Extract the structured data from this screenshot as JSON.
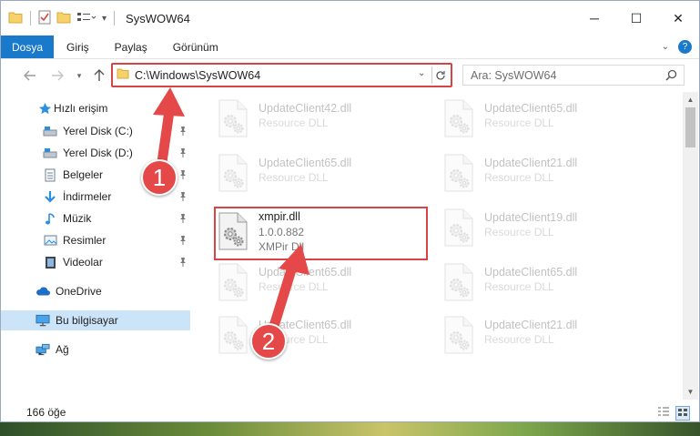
{
  "window": {
    "title": "SysWOW64",
    "controls": {
      "minimize": "─",
      "maximize": "☐",
      "close": "✕"
    }
  },
  "ribbon": {
    "tabs": [
      "Dosya",
      "Giriş",
      "Paylaş",
      "Görünüm"
    ],
    "help": "?"
  },
  "address_bar": {
    "path": "C:\\Windows\\SysWOW64",
    "search_placeholder": "Ara: SysWOW64"
  },
  "navigation": {
    "items": [
      {
        "label": "Hızlı erişim",
        "icon": "star-icon",
        "pinned": false
      },
      {
        "label": "Yerel Disk (C:)",
        "icon": "drive-icon",
        "pinned": true
      },
      {
        "label": "Yerel Disk (D:)",
        "icon": "drive-icon",
        "pinned": true
      },
      {
        "label": "Belgeler",
        "icon": "document-icon",
        "pinned": true
      },
      {
        "label": "İndirmeler",
        "icon": "download-icon",
        "pinned": true
      },
      {
        "label": "Müzik",
        "icon": "music-icon",
        "pinned": true
      },
      {
        "label": "Resimler",
        "icon": "pictures-icon",
        "pinned": true
      },
      {
        "label": "Videolar",
        "icon": "video-icon",
        "pinned": true
      },
      {
        "label": "OneDrive",
        "icon": "cloud-icon",
        "pinned": false
      },
      {
        "label": "Bu bilgisayar",
        "icon": "computer-icon",
        "pinned": false,
        "selected": true
      },
      {
        "label": "Ağ",
        "icon": "network-icon",
        "pinned": false
      }
    ]
  },
  "files": {
    "left_column": [
      {
        "name": "UpdateClient42.dll",
        "type": "Resource DLL",
        "faded": true
      },
      {
        "name": "UpdateClient65.dll",
        "type": "Resource DLL",
        "faded": true
      },
      {
        "name": "xmpir.dll",
        "version": "1.0.0.882",
        "type": "XMPir Dll",
        "faded": false,
        "highlighted": true
      },
      {
        "name": "UpdateClient65.dll",
        "type": "Resource DLL",
        "faded": true
      },
      {
        "name": "UpdateClient65.dll",
        "type": "Resource DLL",
        "faded": true
      }
    ],
    "right_column": [
      {
        "name": "UpdateClient65.dll",
        "type": "Resource DLL",
        "faded": true
      },
      {
        "name": "UpdateClient21.dll",
        "type": "Resource DLL",
        "faded": true
      },
      {
        "name": "UpdateClient19.dll",
        "type": "Resource DLL",
        "faded": true
      },
      {
        "name": "UpdateClient65.dll",
        "type": "Resource DLL",
        "faded": true
      },
      {
        "name": "UpdateClient21.dll",
        "type": "Resource DLL",
        "faded": true
      }
    ]
  },
  "status_bar": {
    "item_count": "166 öğe"
  },
  "annotations": {
    "step1": "1",
    "step2": "2",
    "color": "#e54848"
  }
}
